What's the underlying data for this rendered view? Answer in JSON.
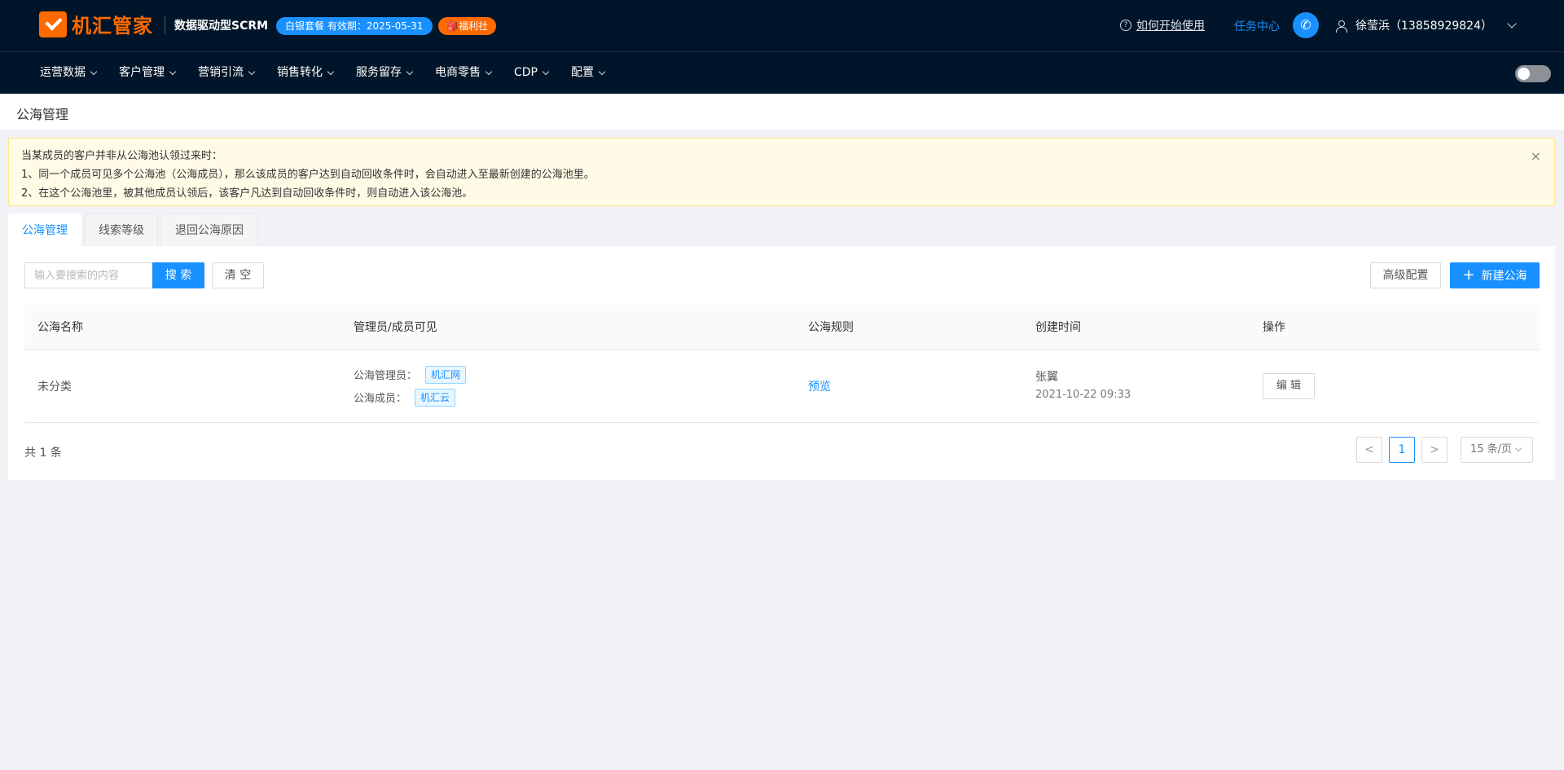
{
  "header": {
    "logo_text": "机汇管家",
    "slogan": "数据驱动型SCRM",
    "plan_badge": "白银套餐 有效期：2025-05-31",
    "welfare_badge": "🎒福利社",
    "help_link": "如何开始使用",
    "task_center": "任务中心",
    "user_name": "徐莹浜（13858929824）"
  },
  "nav": {
    "items": [
      {
        "label": "运营数据"
      },
      {
        "label": "客户管理"
      },
      {
        "label": "营销引流"
      },
      {
        "label": "销售转化"
      },
      {
        "label": "服务留存"
      },
      {
        "label": "电商零售"
      },
      {
        "label": "CDP"
      },
      {
        "label": "配置"
      }
    ]
  },
  "page": {
    "title": "公海管理"
  },
  "alert": {
    "line1": "当某成员的客户并非从公海池认领过来时：",
    "line2": "1、同一个成员可见多个公海池（公海成员），那么该成员的客户达到自动回收条件时，会自动进入至最新创建的公海池里。",
    "line3": "2、在这个公海池里，被其他成员认领后，该客户凡达到自动回收条件时，则自动进入该公海池。",
    "close": "×"
  },
  "tabs": [
    {
      "label": "公海管理",
      "active": true
    },
    {
      "label": "线索等级",
      "active": false
    },
    {
      "label": "退回公海原因",
      "active": false
    }
  ],
  "toolbar": {
    "search_placeholder": "输入要搜索的内容",
    "search_label": "搜 索",
    "clear_label": "清 空",
    "advanced_label": "高级配置",
    "new_label": "新建公海"
  },
  "table": {
    "columns": [
      "公海名称",
      "管理员/成员可见",
      "公海规则",
      "创建时间",
      "操作"
    ],
    "rows": [
      {
        "name": "未分类",
        "admin_label": "公海管理员：",
        "admin_tag": "机汇网",
        "member_label": "公海成员：",
        "member_tag": "机汇云",
        "rule_link": "预览",
        "creator": "张翼",
        "created_at": "2021-10-22 09:33",
        "action": "编 辑"
      }
    ]
  },
  "pagination": {
    "total": "共 1 条",
    "prev": "<",
    "current": "1",
    "next": ">",
    "page_size": "15 条/页"
  },
  "colors": {
    "header_bg": "#001529",
    "primary": "#1890ff",
    "brand_orange": "#ff6a00",
    "alert_bg": "#fffbe6"
  }
}
